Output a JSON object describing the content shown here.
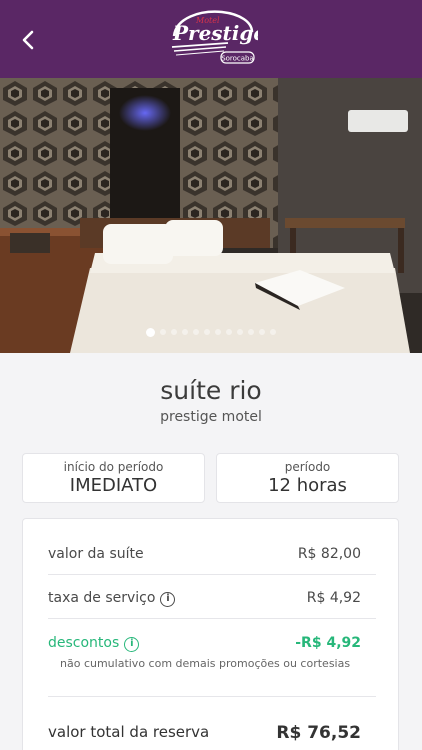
{
  "header": {
    "back_icon": "chevron-left-icon",
    "logo": {
      "small_text": "Motel",
      "brand_text": "Prestige",
      "city_text": "Sorocaba"
    }
  },
  "gallery": {
    "total_images": 12,
    "active_index": 0
  },
  "suite": {
    "name": "suíte rio",
    "motel": "prestige motel"
  },
  "period_start": {
    "label": "início do período",
    "value": "IMEDIATO"
  },
  "period": {
    "label": "período",
    "value": "12 horas"
  },
  "pricing": {
    "suite_value_label": "valor da suíte",
    "suite_value": "R$ 82,00",
    "service_fee_label": "taxa de serviço",
    "service_fee": "R$ 4,92",
    "discounts_label": "descontos",
    "discounts": "-R$ 4,92",
    "discount_note": "não cumulativo com demais promoções ou cortesias",
    "total_label": "valor total da reserva",
    "total": "R$ 76,52"
  },
  "colors": {
    "header_bg": "#5a2765",
    "discount_green": "#27b77a",
    "logo_red": "#d8334a"
  }
}
